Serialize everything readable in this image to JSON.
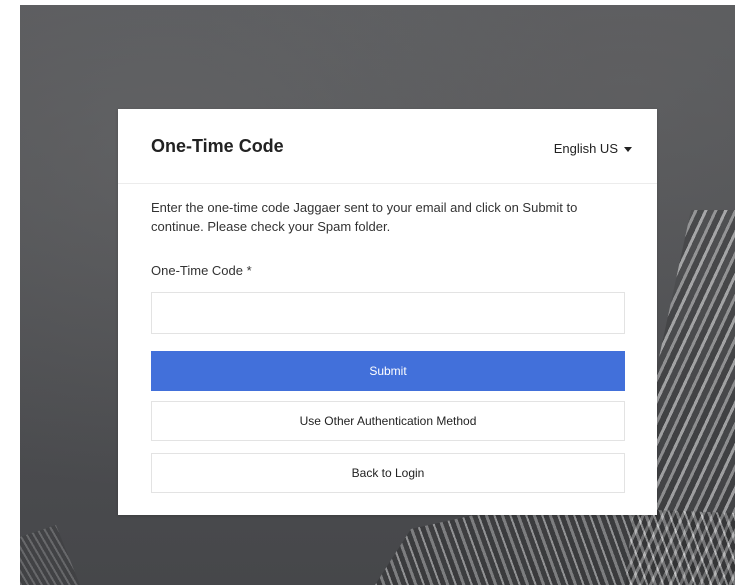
{
  "card": {
    "title": "One-Time Code",
    "language": "English US",
    "instructions": "Enter the one-time code Jaggaer sent to your email and click on Submit to continue. Please check your Spam folder.",
    "field_label": "One-Time Code *",
    "code_value": "",
    "submit_label": "Submit",
    "other_method_label": "Use Other Authentication Method",
    "back_label": "Back to Login"
  },
  "colors": {
    "primary_button": "#4270da",
    "text": "#222222",
    "border": "#e3e3e3"
  },
  "icons": {
    "language_caret": "caret-down-icon"
  }
}
